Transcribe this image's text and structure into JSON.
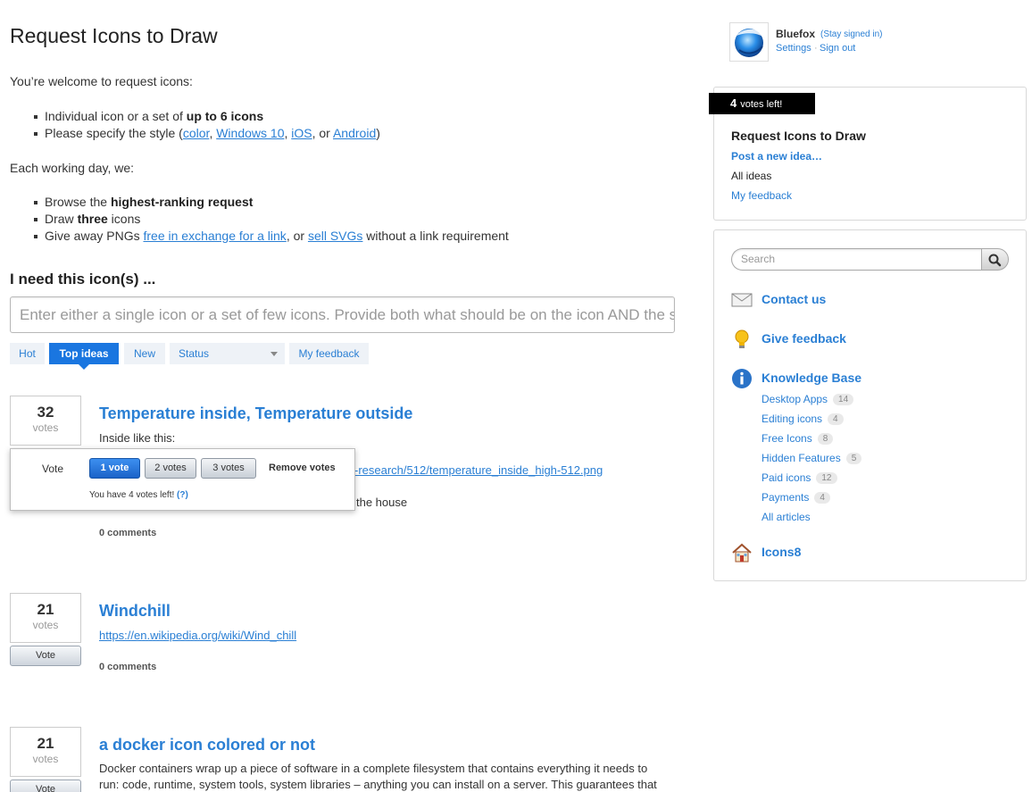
{
  "page": {
    "title": "Request Icons to Draw",
    "intro": "You’re welcome to request icons:",
    "req_bullets": {
      "b1_pre": "Individual icon or a set of ",
      "b1_bold": "up to 6 icons",
      "b2_pre": "Please specify the style (",
      "b2_link1": "color",
      "b2_sep1": ", ",
      "b2_link2": "Windows 10",
      "b2_sep2": ", ",
      "b2_link3": "iOS",
      "b2_sep3": ", or ",
      "b2_link4": "Android",
      "b2_post": ")"
    },
    "each_day": "Each working day, we:",
    "day_bullets": {
      "b1_pre": "Browse the ",
      "b1_bold": "highest-ranking request",
      "b2_pre": "Draw ",
      "b2_bold": "three",
      "b2_post": " icons",
      "b3_pre": "Give away PNGs ",
      "b3_link1": "free in exchange for a link",
      "b3_mid": ", or ",
      "b3_link2": "sell SVGs",
      "b3_post": " without a link requirement"
    },
    "need_heading": "I need this icon(s) ...",
    "idea_placeholder": "Enter either a single icon or a set of few icons. Provide both what should be on the icon AND the style you need."
  },
  "filters": {
    "hot": "Hot",
    "top": "Top ideas",
    "new": "New",
    "status": "Status",
    "my_feedback": "My feedback"
  },
  "ideas": [
    {
      "votes": "32",
      "votes_label": "votes",
      "title": "Temperature inside, Temperature outside",
      "desc": "Inside like this:",
      "link": "-research/512/temperature_inside_high-512.png",
      "desc2": "the house",
      "comments": "0 comments"
    },
    {
      "votes": "21",
      "votes_label": "votes",
      "vote_btn": "Vote",
      "title": "Windchill",
      "link": "https://en.wikipedia.org/wiki/Wind_chill",
      "comments": "0 comments"
    },
    {
      "votes": "21",
      "votes_label": "votes",
      "vote_btn": "Vote",
      "title": "a docker icon colored or not",
      "desc": "Docker containers wrap up a piece of software in a complete filesystem that contains everything it needs to run: code, runtime, system tools, system libraries – anything you can install on a server. This guarantees that"
    }
  ],
  "vote_popup": {
    "label": "Vote",
    "one": "1 vote",
    "two": "2 votes",
    "three": "3 votes",
    "remove": "Remove votes",
    "note": "You have 4 votes left!",
    "help": "(?)"
  },
  "user": {
    "name": "Bluefox",
    "stay": "(Stay signed in)",
    "settings": "Settings",
    "sep": "·",
    "signout": "Sign out"
  },
  "forum_panel": {
    "votes_count": "4",
    "votes_text": "votes left!",
    "title": "Request Icons to Draw",
    "post": "Post a new idea…",
    "all": "All ideas",
    "my_feedback": "My feedback"
  },
  "sidebar": {
    "search_placeholder": "Search",
    "contact": "Contact us",
    "give_feedback": "Give feedback",
    "kb": "Knowledge Base",
    "kb_items": [
      {
        "label": "Desktop Apps",
        "count": "14"
      },
      {
        "label": "Editing icons",
        "count": "4"
      },
      {
        "label": "Free Icons",
        "count": "8"
      },
      {
        "label": "Hidden Features",
        "count": "5"
      },
      {
        "label": "Paid icons",
        "count": "12"
      },
      {
        "label": "Payments",
        "count": "4"
      }
    ],
    "all_articles": "All articles",
    "icons8": "Icons8"
  },
  "icons": {
    "search": "magnifier-icon",
    "contact": "envelope-icon",
    "feedback": "lightbulb-icon",
    "kb": "info-icon",
    "home": "house-icon",
    "avatar": "bluefox-logo"
  },
  "colors": {
    "accent": "#2a7fd4",
    "active_tab": "#1a76e0",
    "votes_badge": "#000000"
  }
}
